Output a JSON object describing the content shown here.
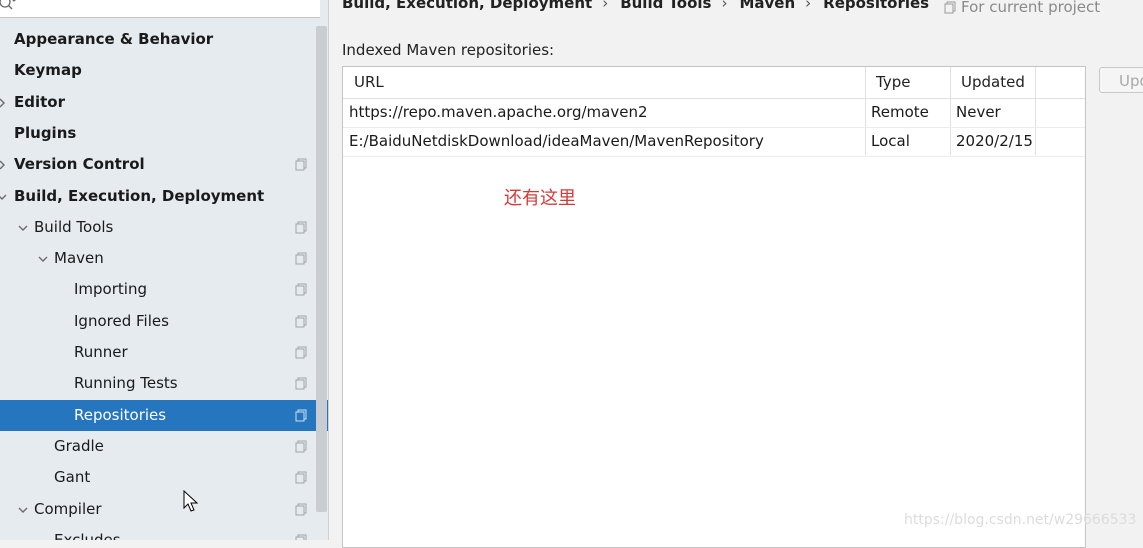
{
  "sidebar": {
    "items": [
      {
        "label": "Appearance & Behavior",
        "bold": true,
        "indent": 0,
        "arrow": "none",
        "proj": false,
        "selected": false
      },
      {
        "label": "Keymap",
        "bold": true,
        "indent": 0,
        "arrow": "none",
        "proj": false,
        "selected": false
      },
      {
        "label": "Editor",
        "bold": true,
        "indent": 0,
        "arrow": "collapsed",
        "proj": false,
        "selected": false
      },
      {
        "label": "Plugins",
        "bold": true,
        "indent": 0,
        "arrow": "none",
        "proj": false,
        "selected": false
      },
      {
        "label": "Version Control",
        "bold": true,
        "indent": 0,
        "arrow": "collapsed",
        "proj": true,
        "selected": false
      },
      {
        "label": "Build, Execution, Deployment",
        "bold": true,
        "indent": 0,
        "arrow": "expanded",
        "proj": false,
        "selected": false
      },
      {
        "label": "Build Tools",
        "bold": false,
        "indent": 1,
        "arrow": "expanded",
        "proj": true,
        "selected": false
      },
      {
        "label": "Maven",
        "bold": false,
        "indent": 2,
        "arrow": "expanded",
        "proj": true,
        "selected": false
      },
      {
        "label": "Importing",
        "bold": false,
        "indent": 3,
        "arrow": "none",
        "proj": true,
        "selected": false
      },
      {
        "label": "Ignored Files",
        "bold": false,
        "indent": 3,
        "arrow": "none",
        "proj": true,
        "selected": false
      },
      {
        "label": "Runner",
        "bold": false,
        "indent": 3,
        "arrow": "none",
        "proj": true,
        "selected": false
      },
      {
        "label": "Running Tests",
        "bold": false,
        "indent": 3,
        "arrow": "none",
        "proj": true,
        "selected": false
      },
      {
        "label": "Repositories",
        "bold": false,
        "indent": 3,
        "arrow": "none",
        "proj": true,
        "selected": true
      },
      {
        "label": "Gradle",
        "bold": false,
        "indent": 2,
        "arrow": "none",
        "proj": true,
        "selected": false
      },
      {
        "label": "Gant",
        "bold": false,
        "indent": 2,
        "arrow": "none",
        "proj": true,
        "selected": false
      },
      {
        "label": "Compiler",
        "bold": false,
        "indent": 1,
        "arrow": "expanded",
        "proj": true,
        "selected": false
      },
      {
        "label": "Excludes",
        "bold": false,
        "indent": 2,
        "arrow": "none",
        "proj": true,
        "selected": false
      }
    ]
  },
  "breadcrumb": {
    "parts": [
      "Build, Execution, Deployment",
      "Build Tools",
      "Maven",
      "Repositories"
    ],
    "separator": "›"
  },
  "for_project": "For current project",
  "section_label": "Indexed Maven repositories:",
  "table": {
    "columns": [
      "URL",
      "Type",
      "Updated"
    ],
    "rows": [
      [
        "https://repo.maven.apache.org/maven2",
        "Remote",
        "Never"
      ],
      [
        "E:/BaiduNetdiskDownload/ideaMaven/MavenRepository",
        "Local",
        "2020/2/15"
      ]
    ]
  },
  "annotation": "还有这里",
  "update_button": "Update",
  "watermark": "https://blog.csdn.net/w29666533",
  "colors": {
    "selection": "#2675bf",
    "sidebar_bg": "#e6ebf0",
    "annotation": "#d33a3a"
  }
}
